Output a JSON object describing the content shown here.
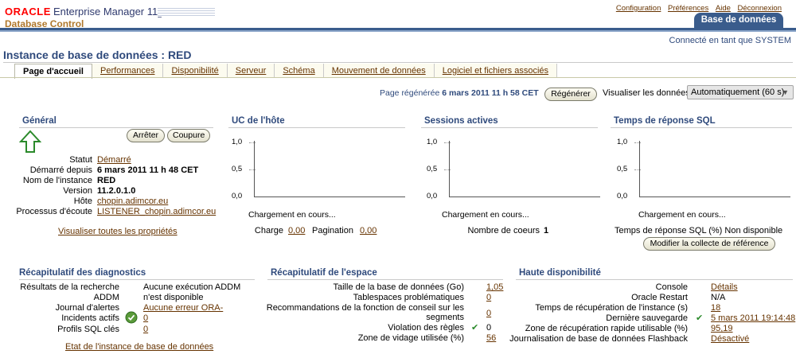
{
  "header": {
    "logo_oracle": "ORACLE",
    "logo_product": "Enterprise Manager 11",
    "logo_version": "g",
    "logo_sub": "Database Control",
    "top_links": [
      "Configuration",
      "Préférences",
      "Aide",
      "Déconnexion"
    ],
    "active_target_tab": "Base de données",
    "connected_as": "Connecté en tant que SYSTEM"
  },
  "page": {
    "title": "Instance de base de données : RED",
    "tabs": [
      "Page d'accueil",
      "Performances",
      "Disponibilité",
      "Serveur",
      "Schéma",
      "Mouvement de données",
      "Logiciel et fichiers associés"
    ],
    "refresh_label": "Page régénérée",
    "refresh_time": "6 mars 2011 11 h 58 CET",
    "refresh_button": "Régénérer",
    "view_data_label": "Visualiser les données",
    "view_data_value": "Automatiquement (60 s)"
  },
  "general": {
    "title": "Général",
    "stop_button": "Arrêter",
    "blackout_button": "Coupure",
    "rows": [
      {
        "label": "Statut",
        "value": "Démarré",
        "link": true
      },
      {
        "label": "Démarré depuis",
        "value": "6 mars 2011 11 h 48 CET",
        "bold": true
      },
      {
        "label": "Nom de l'instance",
        "value": "RED",
        "bold": true
      },
      {
        "label": "Version",
        "value": "11.2.0.1.0",
        "bold": true
      },
      {
        "label": "Hôte",
        "value": "chopin.adimcor.eu",
        "link": true
      },
      {
        "label": "Processus d'écoute",
        "value": "LISTENER_chopin.adimcor.eu",
        "link": true
      }
    ],
    "all_properties_link": "Visualiser toutes les propriétés"
  },
  "host_cpu": {
    "title": "UC de l'hôte",
    "loading": "Chargement en cours...",
    "load_label": "Charge",
    "load_value": "0,00",
    "paging_label": "Pagination",
    "paging_value": "0,00"
  },
  "active_sessions": {
    "title": "Sessions actives",
    "loading": "Chargement en cours...",
    "cores_label": "Nombre de coeurs",
    "cores_value": "1"
  },
  "sql_response": {
    "title": "Temps de réponse SQL",
    "loading": "Chargement en cours...",
    "pct_label": "Temps de réponse SQL (%)",
    "pct_value": "Non disponible",
    "modify_button": "Modifier la collecte de référence"
  },
  "chart_axis_ticks": [
    "1,0",
    "0,5",
    "0,0"
  ],
  "chart_data": [
    {
      "type": "line",
      "title": "UC de l'hôte",
      "ylim": [
        0,
        1
      ],
      "yticks": [
        "1,0",
        "0,5",
        "0,0"
      ],
      "series": []
    },
    {
      "type": "line",
      "title": "Sessions actives",
      "ylim": [
        0,
        1
      ],
      "yticks": [
        "1,0",
        "0,5",
        "0,0"
      ],
      "series": []
    },
    {
      "type": "line",
      "title": "Temps de réponse SQL",
      "ylim": [
        0,
        1
      ],
      "yticks": [
        "1,0",
        "0,5",
        "0,0"
      ],
      "series": []
    }
  ],
  "diagnostics": {
    "title": "Récapitulatif des diagnostics",
    "rows": [
      {
        "label": "Résultats de la recherche",
        "value": "Aucune exécution ADDM",
        "link": false
      },
      {
        "label": "ADDM",
        "value": "n'est disponible",
        "link": false
      },
      {
        "label": "Journal d'alertes",
        "value": "Aucune erreur ORA-",
        "link": true
      },
      {
        "label": "Incidents actifs",
        "value": "0",
        "link": true,
        "icon": "check-circle-icon"
      },
      {
        "label": "Profils SQL clés",
        "value": "0",
        "link": true
      }
    ],
    "state_link": "Etat de l'instance de base de données"
  },
  "space": {
    "title": "Récapitulatif de l'espace",
    "rows": [
      {
        "label": "Taille de la base de données (Go)",
        "value": "1,05",
        "link": true
      },
      {
        "label": "Tablespaces problématiques",
        "value": "0",
        "link": true
      },
      {
        "label": "Recommandations de la fonction de conseil sur les segments",
        "value": "0",
        "link": true
      },
      {
        "label": "Violation des règles",
        "value": "0",
        "link": false,
        "icon": "check-icon"
      },
      {
        "label": "Zone de vidage utilisée (%)",
        "value": "56",
        "link": true
      }
    ]
  },
  "ha": {
    "title": "Haute disponibilité",
    "rows": [
      {
        "label": "Console",
        "value": "Détails",
        "link": true
      },
      {
        "label": "Oracle Restart",
        "value": "N/A",
        "link": false
      },
      {
        "label": "Temps de récupération de l'instance (s)",
        "value": "18",
        "link": true
      },
      {
        "label": "Dernière sauvegarde",
        "value": "5 mars 2011 19:14:48",
        "link": true,
        "icon": "check-icon"
      },
      {
        "label": "Zone de récupération rapide utilisable (%)",
        "value": "95,19",
        "link": true
      },
      {
        "label": "Journalisation de base de données Flashback",
        "value": "Désactivé",
        "link": true
      }
    ]
  },
  "colors": {
    "brand_red": "#ff0000",
    "header_blue": "#3a5c8c",
    "section_title": "#2f4a7c",
    "link": "#663300",
    "status_arrow": "#2b8a2b"
  }
}
